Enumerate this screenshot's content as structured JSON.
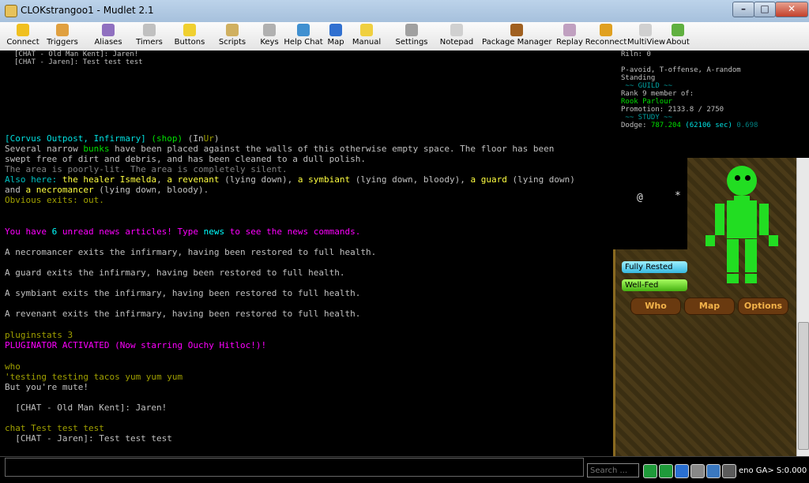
{
  "window": {
    "title": "CLOKstrangoo1 - Mudlet 2.1",
    "min": "–",
    "max": "□",
    "close": "✕"
  },
  "toolbar": [
    {
      "label": "Connect",
      "icon": "connect-icon",
      "color": "#f0c020"
    },
    {
      "label": "Triggers",
      "icon": "triggers-icon",
      "color": "#e0a040"
    },
    {
      "label": "Aliases",
      "icon": "aliases-icon",
      "color": "#9070c0"
    },
    {
      "label": "Timers",
      "icon": "timers-icon",
      "color": "#c0c0c0"
    },
    {
      "label": "Buttons",
      "icon": "buttons-icon",
      "color": "#f0d030"
    },
    {
      "label": "Scripts",
      "icon": "scripts-icon",
      "color": "#d0b060"
    },
    {
      "label": "Keys",
      "icon": "keys-icon",
      "color": "#b0b0b0"
    },
    {
      "label": "Help Chat",
      "icon": "help-chat-icon",
      "color": "#4090d0"
    },
    {
      "label": "Map",
      "icon": "map-icon",
      "color": "#3070d0"
    },
    {
      "label": "Manual",
      "icon": "manual-icon",
      "color": "#f0d040"
    },
    {
      "label": "Settings",
      "icon": "settings-icon",
      "color": "#a0a0a0"
    },
    {
      "label": "Notepad",
      "icon": "notepad-icon",
      "color": "#d0d0d0"
    },
    {
      "label": "Package Manager",
      "icon": "package-icon",
      "color": "#a06020"
    },
    {
      "label": "Replay",
      "icon": "replay-icon",
      "color": "#c0a0c0"
    },
    {
      "label": "Reconnect",
      "icon": "reconnect-icon",
      "color": "#e0a020"
    },
    {
      "label": "MultiView",
      "icon": "multiview-icon",
      "color": "#d0d0d0"
    },
    {
      "label": "About",
      "icon": "about-icon",
      "color": "#60b040"
    }
  ],
  "console": {
    "top_lines": [
      "[CHAT - Old Man Kent]: Jaren!",
      "[CHAT - Jaren]: Test test test"
    ],
    "room_name": "[Corvus Outpost, Infirmary]",
    "room_shop": " (shop)",
    "room_code_a": " (In",
    "room_code_b": "Ur",
    "room_code_c": ")",
    "desc1a": "Several narrow ",
    "desc1b": "bunks",
    "desc1c": " have been placed against the walls of this otherwise empty space. The floor has been",
    "desc2": "swept free of dirt and debris, and has been cleaned to a dull polish.",
    "lighting": "The area is poorly-lit. The area is completely silent.",
    "also_prefix": "Also here: ",
    "healer": "the healer Ismelda",
    "sep1": ", ",
    "revenant": "a revenant",
    "rev_state": " (lying down), ",
    "symbiant": "a symbiant",
    "sym_state": " (lying down, bloody), ",
    "guard": "a guard",
    "guard_state": " (lying down)",
    "also2_prefix": "and ",
    "necro": "a necromancer",
    "necro_state": " (lying down, bloody).",
    "exits": "Obvious exits: out.",
    "news_a": "You have ",
    "news_count": "6",
    "news_b": " unread news articles! Type ",
    "news_cmd": "news",
    "news_c": " to see the news commands.",
    "exit1": "A necromancer exits the infirmary, having been restored to full health.",
    "exit2": "A guard exits the infirmary, having been restored to full health.",
    "exit3": "A symbiant exits the infirmary, having been restored to full health.",
    "exit4": "A revenant exits the infirmary, having been restored to full health.",
    "pluginstats": "pluginstats 3",
    "plugin_active": "PLUGINATOR ACTIVATED (Now starring Ouchy Hitloc!)!",
    "who": "who",
    "say": "'testing testing tacos yum yum yum",
    "mute": "But you're mute!",
    "chat1": "  [CHAT - Old Man Kent]: Jaren!",
    "chat_cmd": "chat Test test test",
    "chat2": "  [CHAT - Jaren]: Test test test"
  },
  "info_panel": {
    "riln": "Riln: 0",
    "stance": "P-avoid, T-offense, A-random",
    "standing": "Standing",
    "guild_header": " ~~ GUILD ~~",
    "rank": "Rank 9 member of:",
    "guild": "Rook Parlour",
    "promotion": "Promotion: 2133.8 / 2750",
    "study_header": " ~~ STUDY ~~",
    "dodge_label": "Dodge: ",
    "dodge_value": "787.204",
    "dodge_secs": " (62106 sec)",
    "dodge_rate": " 0.698"
  },
  "map_panel": {
    "glyph_at": "@",
    "glyph_star": "*"
  },
  "status_pills": {
    "rested": "Fully Rested",
    "fed": "Well-Fed"
  },
  "map_buttons": {
    "who": "Who",
    "map": "Map",
    "options": "Options"
  },
  "bottom": {
    "command_value": "",
    "search_placeholder": "Search ...",
    "status": "eno GA> S:0.000"
  },
  "colors": {
    "room_name": "#00e0e0",
    "shop": "#00e000",
    "bunks": "#00e000",
    "grey_text": "#808080",
    "also": "#00c0c0",
    "npc": "#ffff40",
    "exits": "#a0a000",
    "magenta": "#ff00ff",
    "cyan": "#00ffff",
    "olive": "#a0a000",
    "dodge_value": "#00e000",
    "dodge_secs": "#00e0e0",
    "dodge_rate": "#008080",
    "guild_name": "#00e000",
    "header": "#00a0a0"
  }
}
